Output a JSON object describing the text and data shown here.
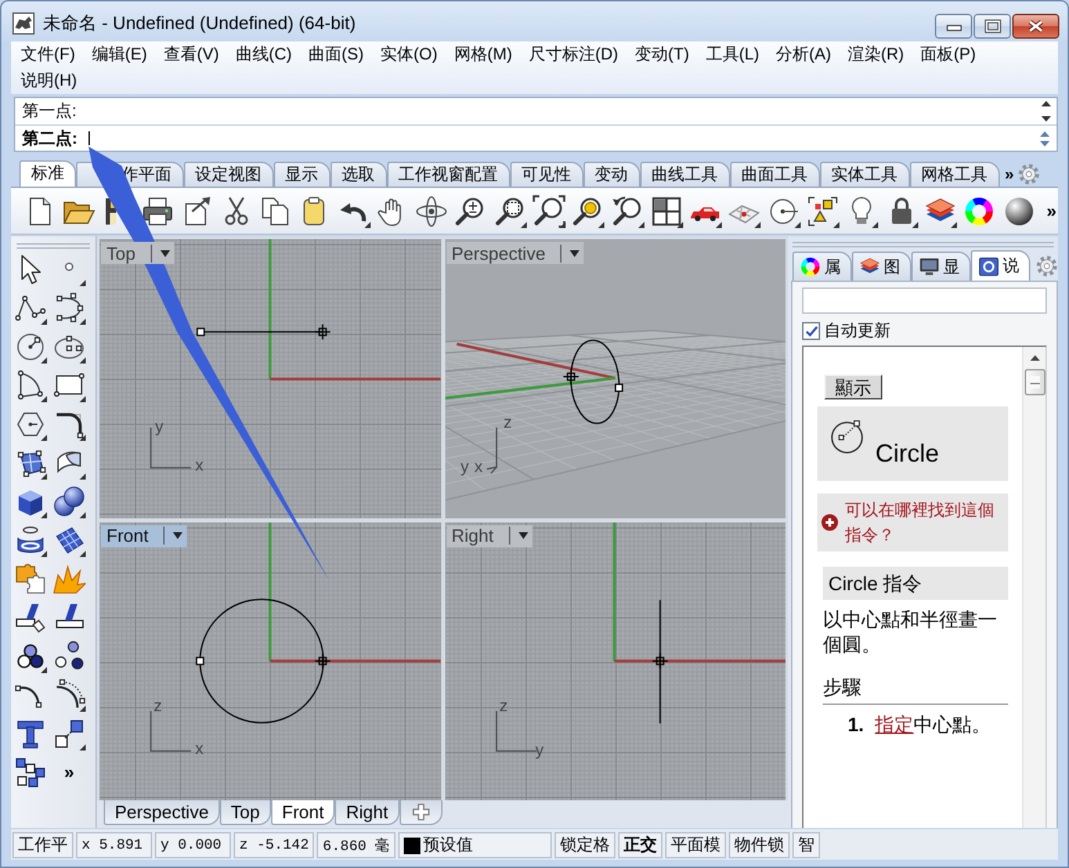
{
  "window": {
    "title": "未命名 - Undefined (Undefined) (64-bit)"
  },
  "menu": [
    "文件(F)",
    "编辑(E)",
    "查看(V)",
    "曲线(C)",
    "曲面(S)",
    "实体(O)",
    "网格(M)",
    "尺寸标注(D)",
    "变动(T)",
    "工具(L)",
    "分析(A)",
    "渲染(R)",
    "面板(P)",
    "说明(H)"
  ],
  "command_area": {
    "history": [
      "第一点:"
    ],
    "prompt": "第二点:"
  },
  "toolbar": {
    "tabs": [
      {
        "label": "标准",
        "selected": true
      },
      {
        "label": "作平面",
        "selected": false
      },
      {
        "label": "设定视图",
        "selected": false
      },
      {
        "label": "显示",
        "selected": false
      },
      {
        "label": "选取",
        "selected": false
      },
      {
        "label": "工作视窗配置",
        "selected": false
      },
      {
        "label": "可见性",
        "selected": false
      },
      {
        "label": "变动",
        "selected": false
      },
      {
        "label": "曲线工具",
        "selected": false
      },
      {
        "label": "曲面工具",
        "selected": false
      },
      {
        "label": "实体工具",
        "selected": false
      },
      {
        "label": "网格工具",
        "selected": false
      }
    ],
    "more_tabs": "»",
    "more_tools": "»"
  },
  "side_toolbar": {
    "more": "»"
  },
  "viewports": [
    {
      "title": "Top",
      "kind": "top",
      "selected": false,
      "axis_labels": [
        "y",
        "x"
      ]
    },
    {
      "title": "Perspective",
      "kind": "perspective",
      "selected": false,
      "axis_labels": [
        "z",
        "y",
        "x"
      ]
    },
    {
      "title": "Front",
      "kind": "front",
      "selected": true,
      "axis_labels": [
        "z",
        "x"
      ]
    },
    {
      "title": "Right",
      "kind": "right",
      "selected": false,
      "axis_labels": [
        "z",
        "y"
      ]
    }
  ],
  "viewport_tabs": [
    {
      "label": "Perspective",
      "selected": false
    },
    {
      "label": "Top",
      "selected": false
    },
    {
      "label": "Front",
      "selected": true
    },
    {
      "label": "Right",
      "selected": false
    }
  ],
  "panel": {
    "tabs": [
      {
        "label": "属",
        "kind": "properties",
        "selected": false
      },
      {
        "label": "图",
        "kind": "layers",
        "selected": false
      },
      {
        "label": "显",
        "kind": "display",
        "selected": false
      },
      {
        "label": "说",
        "kind": "help",
        "selected": true
      }
    ],
    "auto_update": {
      "label": "自动更新",
      "checked": true
    },
    "help": {
      "button": "顯示",
      "command": "Circle",
      "link": "可以在哪裡找到這個指令？",
      "heading": "Circle 指令",
      "description": "以中心點和半徑畫一個圓。",
      "steps_title": "步驟",
      "steps": [
        {
          "number": "1.",
          "link": "指定",
          "text": "中心點。"
        }
      ]
    }
  },
  "status_bar": [
    {
      "kind": "text",
      "text": "工作平"
    },
    {
      "kind": "coord",
      "text": "x 5.891"
    },
    {
      "kind": "coord",
      "text": "y 0.000"
    },
    {
      "kind": "coord",
      "text": "z -5.142"
    },
    {
      "kind": "coord",
      "text": "6.860 毫"
    },
    {
      "kind": "layer",
      "text": "预设值",
      "color": "#000000"
    },
    {
      "kind": "toggle",
      "text": "锁定格",
      "on": false
    },
    {
      "kind": "toggle",
      "text": "正交",
      "on": true
    },
    {
      "kind": "toggle",
      "text": "平面模",
      "on": false
    },
    {
      "kind": "toggle",
      "text": "物件锁",
      "on": false
    },
    {
      "kind": "toggle",
      "text": "智",
      "on": false
    }
  ]
}
